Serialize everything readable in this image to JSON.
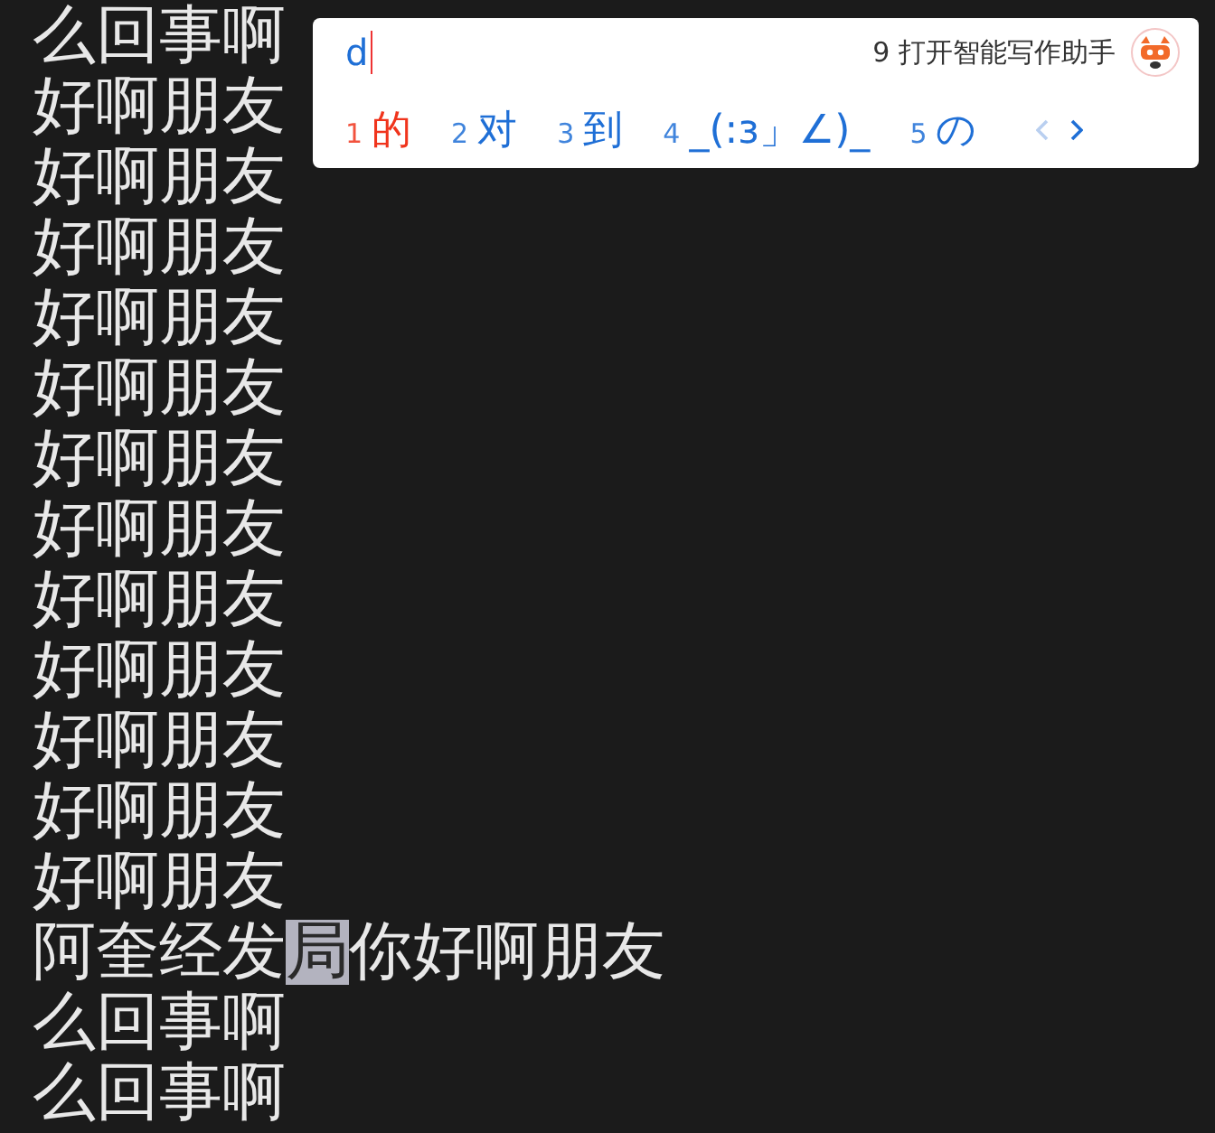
{
  "editor": {
    "lines": [
      {
        "parts": [
          {
            "text": "么回事啊",
            "selected": false
          }
        ]
      },
      {
        "parts": [
          {
            "text": "好啊朋友",
            "selected": false
          }
        ]
      },
      {
        "parts": [
          {
            "text": "好啊朋友",
            "selected": false
          }
        ]
      },
      {
        "parts": [
          {
            "text": "好啊朋友",
            "selected": false
          }
        ]
      },
      {
        "parts": [
          {
            "text": "好啊朋友",
            "selected": false
          }
        ]
      },
      {
        "parts": [
          {
            "text": "好啊朋友",
            "selected": false
          }
        ]
      },
      {
        "parts": [
          {
            "text": "好啊朋友",
            "selected": false
          }
        ]
      },
      {
        "parts": [
          {
            "text": "好啊朋友",
            "selected": false
          }
        ]
      },
      {
        "parts": [
          {
            "text": "好啊朋友",
            "selected": false
          }
        ]
      },
      {
        "parts": [
          {
            "text": "好啊朋友",
            "selected": false
          }
        ]
      },
      {
        "parts": [
          {
            "text": "好啊朋友",
            "selected": false
          }
        ]
      },
      {
        "parts": [
          {
            "text": "好啊朋友",
            "selected": false
          }
        ]
      },
      {
        "parts": [
          {
            "text": "好啊朋友",
            "selected": false
          }
        ]
      },
      {
        "parts": [
          {
            "text": "阿奎经发",
            "selected": false
          },
          {
            "text": "局",
            "selected": true
          },
          {
            "text": "你好啊朋友",
            "selected": false
          }
        ]
      },
      {
        "parts": [
          {
            "text": "么回事啊",
            "selected": false
          }
        ]
      },
      {
        "parts": [
          {
            "text": "么回事啊",
            "selected": false
          }
        ]
      }
    ]
  },
  "ime": {
    "input": "d",
    "assistant": {
      "key": "9",
      "label": "打开智能写作助手"
    },
    "candidates": [
      {
        "key": "1",
        "text": "的",
        "selected": true
      },
      {
        "key": "2",
        "text": "对",
        "selected": false
      },
      {
        "key": "3",
        "text": "到",
        "selected": false
      },
      {
        "key": "4",
        "text": "_(:з」∠)_",
        "selected": false
      },
      {
        "key": "5",
        "text": "の",
        "selected": false
      }
    ],
    "prev_page": {
      "disabled": true
    },
    "next_page": {
      "disabled": false
    }
  }
}
